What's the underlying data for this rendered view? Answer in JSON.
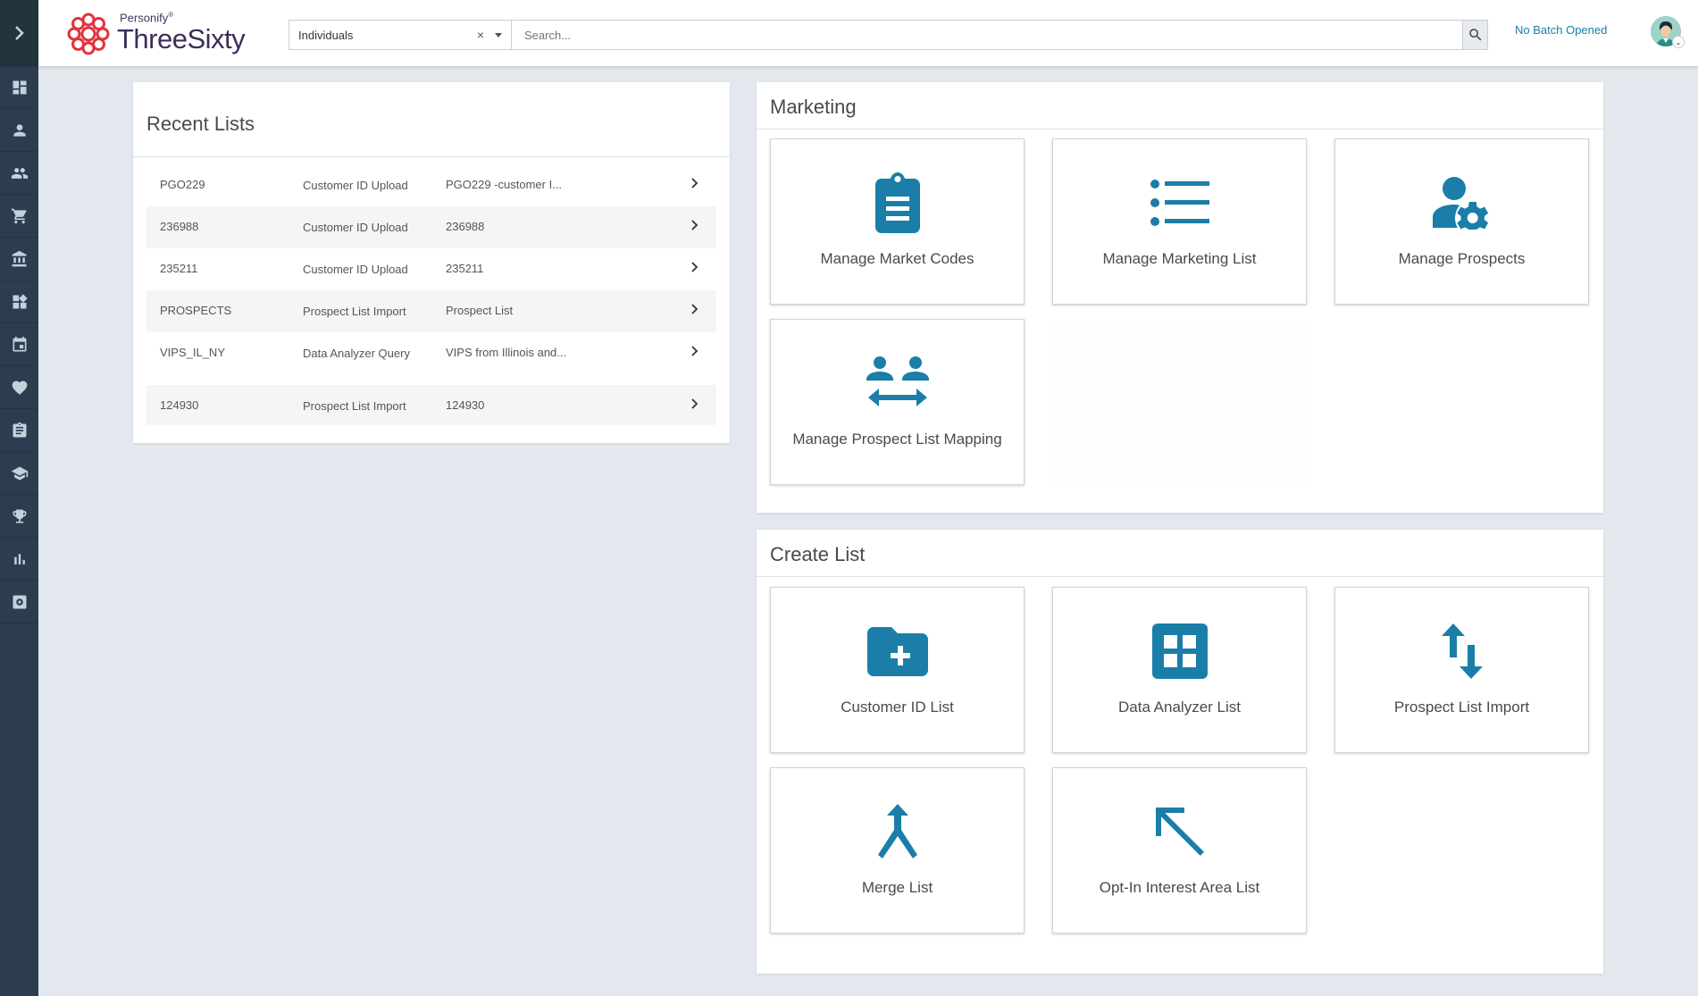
{
  "app": {
    "brand_small": "Personify",
    "brand_small_mark": "®",
    "brand_name": "ThreeSixty",
    "batch_status": "No Batch Opened"
  },
  "search": {
    "selected": "Individuals",
    "clear": "×",
    "placeholder": "Search..."
  },
  "sidebar": {
    "items": [
      {
        "icon": "dashboard-icon"
      },
      {
        "icon": "person-icon"
      },
      {
        "icon": "people-icon"
      },
      {
        "icon": "cart-icon"
      },
      {
        "icon": "bank-icon"
      },
      {
        "icon": "widgets-icon"
      },
      {
        "icon": "calendar-icon"
      },
      {
        "icon": "heart-icon"
      },
      {
        "icon": "clipboard-icon"
      },
      {
        "icon": "graduation-cap-icon"
      },
      {
        "icon": "trophy-icon"
      },
      {
        "icon": "bar-chart-icon"
      },
      {
        "icon": "settings-box-icon"
      }
    ]
  },
  "recent_lists": {
    "title": "Recent Lists",
    "rows": [
      {
        "code": "PGO229",
        "type": "Customer ID Upload",
        "desc": "PGO229 -customer I..."
      },
      {
        "code": "236988",
        "type": "Customer ID Upload",
        "desc": "236988"
      },
      {
        "code": "235211",
        "type": "Customer ID Upload",
        "desc": "235211"
      },
      {
        "code": "PROSPECTS",
        "type": "Prospect List Import",
        "desc": "Prospect List"
      },
      {
        "code": "VIPS_IL_NY",
        "type": "Data Analyzer Query",
        "desc": "VIPS from Illinois and..."
      },
      {
        "code": "124930",
        "type": "Prospect List Import",
        "desc": "124930"
      }
    ]
  },
  "marketing": {
    "title": "Marketing",
    "tiles": [
      {
        "label": "Manage Market Codes",
        "icon": "clipboard-list-icon"
      },
      {
        "label": "Manage Marketing List",
        "icon": "list-icon"
      },
      {
        "label": "Manage Prospects",
        "icon": "person-gear-icon"
      },
      {
        "label": "Manage Prospect List Mapping",
        "icon": "people-arrows-icon"
      }
    ]
  },
  "create_list": {
    "title": "Create List",
    "tiles": [
      {
        "label": "Customer ID List",
        "icon": "folder-plus-icon"
      },
      {
        "label": "Data Analyzer List",
        "icon": "grid-box-icon"
      },
      {
        "label": "Prospect List Import",
        "icon": "swap-vertical-icon"
      },
      {
        "label": "Merge List",
        "icon": "merge-icon"
      },
      {
        "label": "Opt-In Interest Area List",
        "icon": "arrow-up-left-icon"
      }
    ]
  },
  "colors": {
    "accent": "#1a7ea8",
    "sidebar": "#2b3d4f",
    "background": "#e3e8ee"
  }
}
